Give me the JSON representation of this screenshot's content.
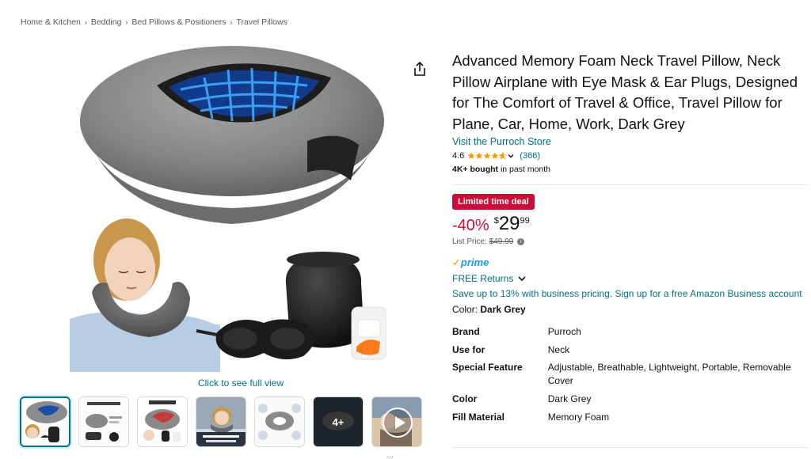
{
  "breadcrumb": [
    "Home & Kitchen",
    "Bedding",
    "Bed Pillows & Positioners",
    "Travel Pillows"
  ],
  "breadcrumb_separator": "›",
  "gallery": {
    "see_full_view": "Click to see full view",
    "more_count": "4+",
    "thumb_caption": "…"
  },
  "product": {
    "title": "Advanced Memory Foam Neck Travel Pillow, Neck Pillow Airplane with Eye Mask & Ear Plugs, Designed for The Comfort of Travel & Office, Travel Pillow for Plane, Car, Home, Work, Dark Grey",
    "store_link": "Visit the Purroch Store",
    "rating": "4.6",
    "rating_stars": 4.6,
    "rating_count": "(366)",
    "bought_bold": "4K+ bought",
    "bought_rest": " in past month",
    "deal_badge": "Limited time deal",
    "discount": "-40%",
    "price_symbol": "$",
    "price_whole": "29",
    "price_fraction": "99",
    "list_price_label": "List Price:",
    "list_price": "$49.99",
    "prime_check": "✓",
    "prime_label": "prime",
    "free_returns": "FREE Returns",
    "business_text": "Save up to 13% with business pricing. Sign up for a free Amazon Business account",
    "color_label": "Color:",
    "color_value": "Dark Grey"
  },
  "specs": [
    {
      "key": "Brand",
      "value": "Purroch"
    },
    {
      "key": "Use for",
      "value": "Neck"
    },
    {
      "key": "Special Feature",
      "value": "Adjustable, Breathable, Lightweight, Portable, Removable Cover"
    },
    {
      "key": "Color",
      "value": "Dark Grey"
    },
    {
      "key": "Fill Material",
      "value": "Memory Foam"
    }
  ],
  "colors": {
    "link": "#007185",
    "deal_red": "#cc0c39",
    "star": "#ff9900",
    "prime_blue": "#1a98ff"
  },
  "icons": {
    "share": "share-icon",
    "chevron": "chevron-down-icon",
    "info": "info-icon",
    "star": "star-icon",
    "play": "play-icon"
  }
}
